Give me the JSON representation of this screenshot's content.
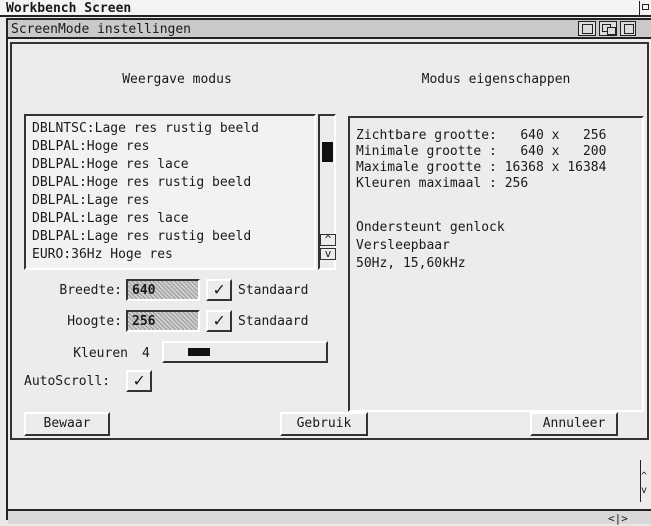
{
  "screen": {
    "title": "Workbench Screen"
  },
  "window": {
    "title": "ScreenMode instellingen"
  },
  "display_mode": {
    "header": "Weergave modus",
    "items": [
      "DBLNTSC:Lage res rustig beeld",
      "DBLPAL:Hoge res",
      "DBLPAL:Hoge res lace",
      "DBLPAL:Hoge res rustig beeld",
      "DBLPAL:Lage res",
      "DBLPAL:Lage res lace",
      "DBLPAL:Lage res rustig beeld",
      "EURO:36Hz Hoge res"
    ]
  },
  "properties": {
    "header": "Modus eigenschappen",
    "lines": [
      "Zichtbare grootte:   640 x   256",
      "Minimale grootte :   640 x   200",
      "Maximale grootte : 16368 x 16384",
      "Kleuren maximaal : 256",
      "",
      "Ondersteunt genlock",
      "Versleepbaar",
      "50Hz, 15,60kHz"
    ]
  },
  "width": {
    "label": "Breedte:",
    "value": "640",
    "check": "✓",
    "check_label": "Standaard"
  },
  "height": {
    "label": "Hoogte:",
    "value": "256",
    "check": "✓",
    "check_label": "Standaard"
  },
  "colors": {
    "label": "Kleuren",
    "value": "4",
    "slider_fraction": 0.1
  },
  "autoscroll": {
    "label": "AutoScroll:",
    "check": "✓"
  },
  "buttons": {
    "save": "Bewaar",
    "use": "Gebruik",
    "cancel": "Annuleer"
  }
}
